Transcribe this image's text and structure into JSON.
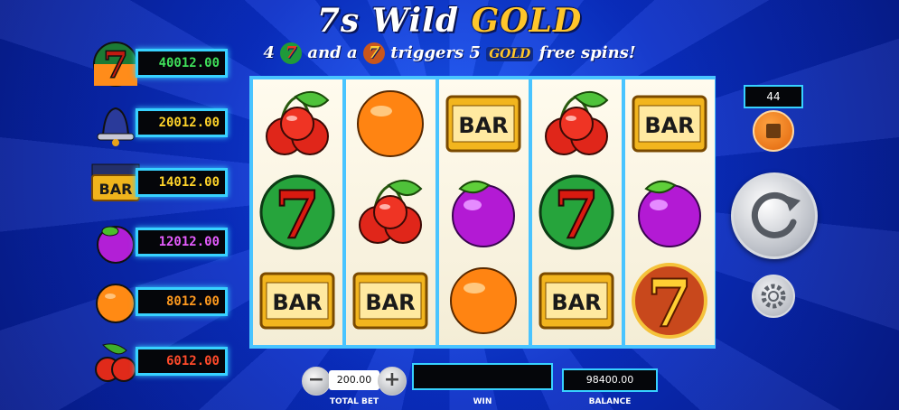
{
  "title": {
    "part1": "7s Wild ",
    "part2": "GOLD"
  },
  "subtitle": {
    "p1": "4",
    "p2": "and a",
    "p3": "triggers 5",
    "gold": "GOLD",
    "p4": "free spins!"
  },
  "paytable": [
    {
      "symbol": "wild-seven",
      "value": "40012.00",
      "color": "#3fe05a"
    },
    {
      "symbol": "bell",
      "value": "20012.00",
      "color": "#ffd42a"
    },
    {
      "symbol": "bar",
      "value": "14012.00",
      "color": "#ffd42a"
    },
    {
      "symbol": "plum",
      "value": "12012.00",
      "color": "#e55cff"
    },
    {
      "symbol": "orange",
      "value": "8012.00",
      "color": "#ff9a1e"
    },
    {
      "symbol": "cherry",
      "value": "6012.00",
      "color": "#ff4a2a"
    }
  ],
  "reels": [
    [
      "cherry",
      "green-seven",
      "bar"
    ],
    [
      "orange",
      "cherry",
      "bar"
    ],
    [
      "bar",
      "plum",
      "orange"
    ],
    [
      "cherry",
      "green-seven",
      "bar"
    ],
    [
      "bar",
      "plum",
      "red-seven"
    ]
  ],
  "controls": {
    "lines": "44",
    "total_bet": "200.00",
    "total_bet_label": "TOTAL BET",
    "win": "",
    "win_label": "WIN",
    "balance": "98400.00",
    "balance_label": "BALANCE",
    "minus": "−",
    "plus": "+"
  },
  "colors": {
    "accent": "#37d1ff",
    "gold": "#ffc62a",
    "background": "#0a2fc8"
  }
}
